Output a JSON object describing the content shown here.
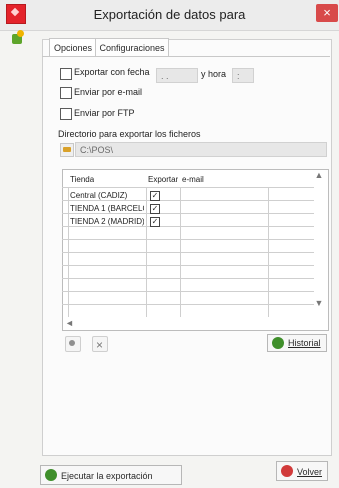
{
  "window": {
    "title": "Exportación de datos para",
    "close_symbol": "×"
  },
  "tabs": {
    "options": "Opciones",
    "config": "Configuraciones"
  },
  "options": {
    "export_with_date_label": "Exportar con fecha",
    "date_value": ". .",
    "time_label": "y hora",
    "time_value": ":",
    "send_email_label": "Enviar por e-mail",
    "send_ftp_label": "Enviar por FTP",
    "dir_label": "Directorio para exportar los ficheros",
    "dir_value": "C:\\POS\\"
  },
  "table": {
    "headers": [
      "Tienda",
      "Exportar",
      "e-mail"
    ],
    "rows": [
      {
        "store": "Central (CADIZ)",
        "export": true
      },
      {
        "store": "TIENDA 1 (BARCELO",
        "export": true
      },
      {
        "store": "TIENDA 2 (MADRID)",
        "export": true
      }
    ]
  },
  "buttons": {
    "history": "Historial",
    "execute": "Ejecutar la exportación",
    "back": "Volver"
  },
  "colors": {
    "accent_green": "#3f8f2b",
    "danger_red": "#d13a3a"
  },
  "icons": {
    "app": "app-icon",
    "history": "history-icon",
    "execute": "execute-icon",
    "back": "back-icon"
  }
}
